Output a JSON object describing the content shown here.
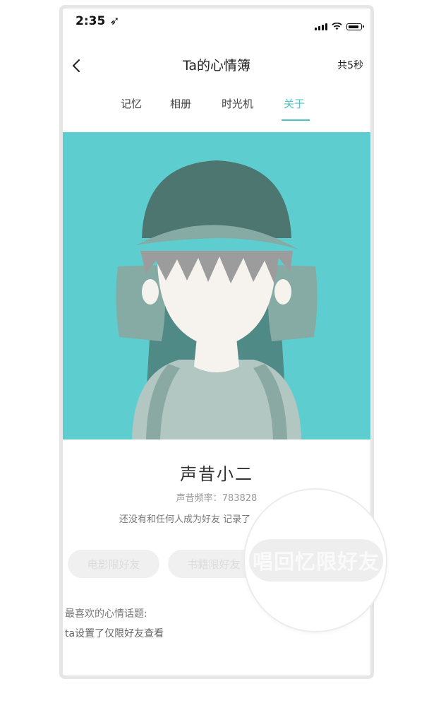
{
  "status_bar": {
    "time": "2:35 ➶"
  },
  "nav": {
    "title": "Ta的心情簿",
    "right_text": "共5秒"
  },
  "tabs": [
    {
      "label": "记忆"
    },
    {
      "label": "相册"
    },
    {
      "label": "时光机"
    },
    {
      "label": "关于",
      "active": true
    }
  ],
  "colors": {
    "accent": "#4fc3c3",
    "hero_bg": "#5dcdd0"
  },
  "profile": {
    "name": "声昔小二",
    "freq_label": "声昔频率：",
    "freq_value": "783828",
    "friends_note": "还没有和任何人成为好友 记录了"
  },
  "pills": {
    "movie": "电影限好友",
    "books": "书籍限好友",
    "song_memory": "唱回忆限好友"
  },
  "favorite": {
    "title": "最喜欢的心情话题:",
    "value": "ta设置了仅限好友查看"
  },
  "icons": {
    "back": "chevron-left-icon",
    "signal": "signal-icon",
    "wifi": "wifi-icon",
    "battery": "battery-icon",
    "avatar": "avatar-illustration"
  }
}
